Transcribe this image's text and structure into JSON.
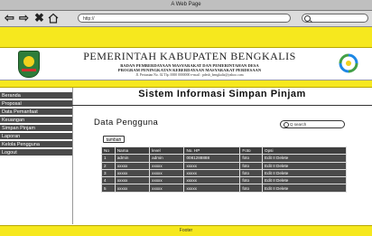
{
  "browser": {
    "window_title": "A Web Page",
    "address": "http://"
  },
  "header": {
    "title": "PEMERINTAH KABUPATEN BENGKALIS",
    "line1": "BADAN PEMBERDAYAAN MASYARAKAT DAN PEMERINTAHAN DESA",
    "line2": "PROGRAM PENINGKATAN KEBERDAYAAN MASYARAKAT PERDESAAN",
    "address": "Jl. Pertanian No. 02 Tlp. 0000 0000000 e-mail : pdesb_bengkalis@yahoo.com"
  },
  "sidebar": {
    "items": [
      {
        "label": "Beranda"
      },
      {
        "label": "Proposal"
      },
      {
        "label": "Data Pemanfaat"
      },
      {
        "label": "Keuangan"
      },
      {
        "label": "Simpan Pinjam"
      },
      {
        "label": "Laporan"
      },
      {
        "label": "Kelola Pengguna"
      },
      {
        "label": "Logout"
      }
    ]
  },
  "main": {
    "title": "Sistem Informasi Simpan Pinjam",
    "section_title": "Data Pengguna",
    "search_placeholder": "Q search",
    "add_button": "tambah"
  },
  "table": {
    "headers": [
      "No",
      "Nama",
      "level",
      "No. HP",
      "Foto",
      "Opsi"
    ],
    "rows": [
      [
        "1",
        "admin",
        "admin",
        "0081288888",
        "foto",
        "Edit II Delete"
      ],
      [
        "2",
        "xxxxx",
        "xxxxx",
        "xxxxx",
        "foto",
        "Edit II Delete"
      ],
      [
        "3",
        "xxxxx",
        "xxxxx",
        "xxxxx",
        "foto",
        "Edit II Delete"
      ],
      [
        "4",
        "xxxxx",
        "xxxxx",
        "xxxxx",
        "foto",
        "Edit II Delete"
      ],
      [
        "5",
        "xxxxx",
        "xxxxx",
        "xxxxx",
        "foto",
        "Edit II Delete"
      ]
    ]
  },
  "footer": {
    "text": "Footer"
  },
  "colors": {
    "accent_yellow": "#f6e81e",
    "menu_dark": "#4a4a4a"
  },
  "icons": [
    "back-arrow-icon",
    "forward-arrow-icon",
    "close-icon",
    "home-icon",
    "search-icon"
  ]
}
